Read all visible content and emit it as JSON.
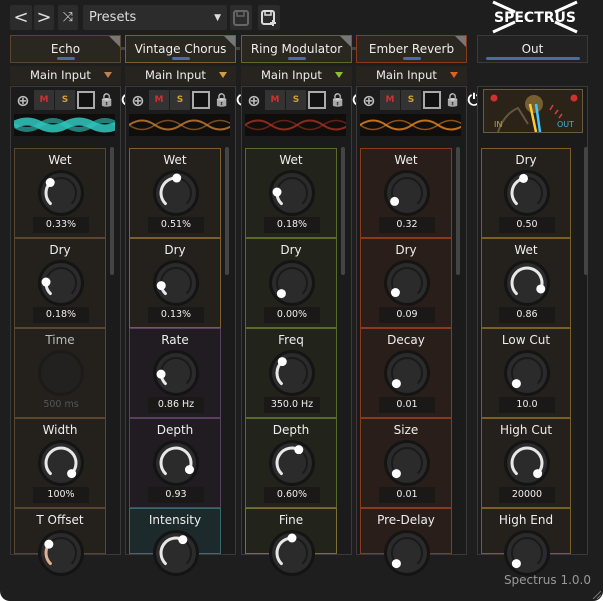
{
  "toolbar": {
    "prev": "<",
    "next": ">",
    "preset": "Presets"
  },
  "logo": "SPECTRUS",
  "accent": "#4c6aa8",
  "columns": [
    {
      "title": "Echo",
      "input": "Main Input",
      "tri": "#c08050",
      "border": "#5a4630",
      "bg": "#24211d",
      "wave": "#30c8c0",
      "params": [
        {
          "label": "Wet",
          "value": "0.33%",
          "level": 0.33
        },
        {
          "label": "Dry",
          "value": "0.18%",
          "level": 0.18
        },
        {
          "label": "Time",
          "value": "500 ms",
          "level": 0,
          "disabled": true
        },
        {
          "label": "Width",
          "value": "100%",
          "level": 1
        },
        {
          "label": "T Offset",
          "value": "",
          "level": 0.3,
          "arc": "#e0b090"
        }
      ]
    },
    {
      "title": "Vintage Chorus",
      "input": "Main Input",
      "tri": "#d0a040",
      "border": "#7a6030",
      "bg": "#24211d",
      "wave": "#c07830",
      "params": [
        {
          "label": "Wet",
          "value": "0.51%",
          "level": 0.51
        },
        {
          "label": "Dry",
          "value": "0.13%",
          "level": 0.13
        },
        {
          "label": "Rate",
          "value": "0.86 Hz",
          "level": 0.15,
          "border": "#5a4060",
          "bg": "#201c22"
        },
        {
          "label": "Depth",
          "value": "0.93",
          "level": 0.93,
          "border": "#5a4060",
          "bg": "#201c22"
        },
        {
          "label": "Intensity",
          "value": "",
          "level": 0.6,
          "border": "#3a6a70",
          "bg": "#1c2a2c"
        }
      ]
    },
    {
      "title": "Ring Modulator",
      "input": "Main Input",
      "tri": "#90c030",
      "border": "#5a6a2a",
      "bg": "#22241c",
      "wave": "#a03020",
      "params": [
        {
          "label": "Wet",
          "value": "0.18%",
          "level": 0.18
        },
        {
          "label": "Dry",
          "value": "0.00%",
          "level": 0
        },
        {
          "label": "Freq",
          "value": "350.0 Hz",
          "level": 0.35
        },
        {
          "label": "Depth",
          "value": "0.60%",
          "level": 0.6
        },
        {
          "label": "Fine",
          "value": "",
          "level": 0.5,
          "border": "#7a7030"
        }
      ]
    },
    {
      "title": "Ember Reverb",
      "input": "Main Input",
      "tri": "#e06020",
      "border": "#8a3a1a",
      "bg": "#2a1e1a",
      "wave": "#e08020",
      "params": [
        {
          "label": "Wet",
          "value": "0.32",
          "level": 0.04
        },
        {
          "label": "Dry",
          "value": "0.09",
          "level": 0.02
        },
        {
          "label": "Decay",
          "value": "0.01",
          "level": 0
        },
        {
          "label": "Size",
          "value": "0.01",
          "level": 0
        },
        {
          "label": "Pre-Delay",
          "value": "",
          "level": 0
        }
      ]
    }
  ],
  "out": {
    "title": "Out",
    "meter_in": "IN",
    "meter_out": "OUT",
    "border": "#7a6020",
    "bg": "#24211d",
    "params": [
      {
        "label": "Dry",
        "value": "0.50",
        "level": 0.45
      },
      {
        "label": "Wet",
        "value": "0.86",
        "level": 0.92
      },
      {
        "label": "Low Cut",
        "value": "10.0",
        "level": 0
      },
      {
        "label": "High Cut",
        "value": "20000",
        "level": 1
      },
      {
        "label": "High End",
        "value": "",
        "level": 0
      }
    ]
  },
  "footer": "Spectrus 1.0.0"
}
